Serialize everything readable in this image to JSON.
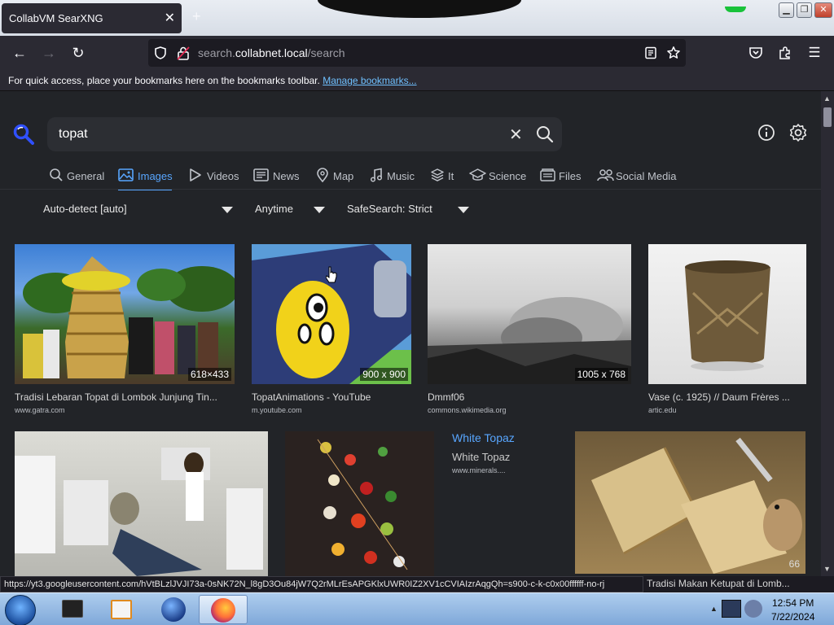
{
  "browser": {
    "tab_title": "CollabVM SearXNG",
    "tab_close": "✕",
    "new_tab": "+",
    "url_host_prefix": "search.",
    "url_host": "collabnet.local",
    "url_path": "/search",
    "bookmarks_text": "For quick access, place your bookmarks here on the bookmarks toolbar.",
    "bookmarks_link": "Manage bookmarks..."
  },
  "search": {
    "query": "topat",
    "clear": "✕"
  },
  "categories": [
    {
      "label": "General",
      "icon": "search-icon"
    },
    {
      "label": "Images",
      "icon": "image-icon",
      "active": true
    },
    {
      "label": "Videos",
      "icon": "play-icon"
    },
    {
      "label": "News",
      "icon": "newspaper-icon"
    },
    {
      "label": "Map",
      "icon": "map-pin-icon"
    },
    {
      "label": "Music",
      "icon": "music-icon"
    },
    {
      "label": "It",
      "icon": "layers-icon"
    },
    {
      "label": "Science",
      "icon": "graduation-cap-icon"
    },
    {
      "label": "Files",
      "icon": "files-icon"
    },
    {
      "label": "Social Media",
      "icon": "people-icon"
    }
  ],
  "filters": {
    "language": "Auto-detect [auto]",
    "time": "Anytime",
    "safesearch": "SafeSearch: Strict"
  },
  "results": [
    {
      "title": "Tradisi Lebaran Topat di Lombok Junjung Tin...",
      "source": "www.gatra.com",
      "dims": "618×433"
    },
    {
      "title": "TopatAnimations - YouTube",
      "source": "m.youtube.com",
      "dims": "900 x 900"
    },
    {
      "title": "Dmmf06",
      "source": "commons.wikimedia.org",
      "dims": "1005 x 768"
    },
    {
      "title": "Vase (c. 1925) // Daum Frères ...",
      "source": "artic.edu",
      "dims": ""
    },
    {
      "title": "White Topaz",
      "source": "www.minerals....",
      "dims": ""
    },
    {
      "title": "Tradisi Makan Ketupat di Lomb...",
      "source": "",
      "dims": "66"
    }
  ],
  "result_link": "White Topaz",
  "status_url": "https://yt3.googleusercontent.com/hVtBLzlJVJI73a-0sNK72N_l8gD3Ou84jW7Q2rMLrEsAPGKlxUWR0IZ2XV1cCVIAIzrAqgQh=s900-c-k-c0x00ffffff-no-rj",
  "taskbar": {
    "time": "12:54 PM",
    "date": "7/22/2024"
  },
  "colors": {
    "accent": "#58a6ff",
    "page_bg": "#222428",
    "chrome_bg": "#2b2a33"
  }
}
